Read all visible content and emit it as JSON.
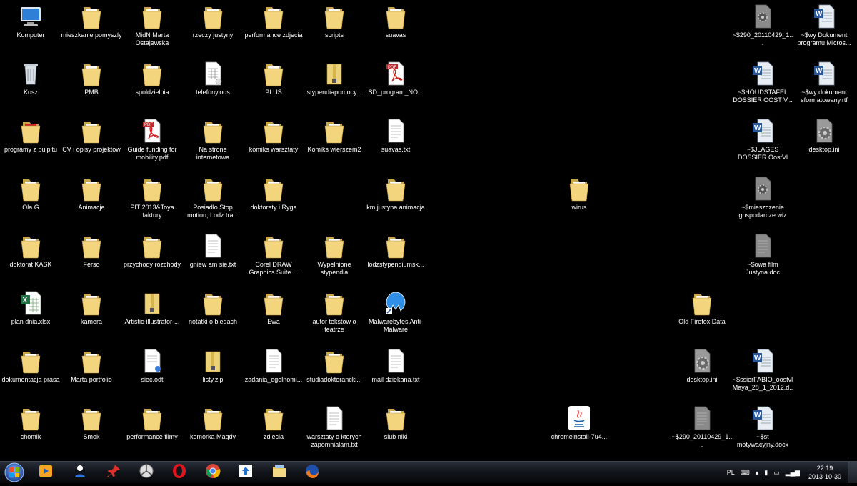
{
  "desktop": {
    "icons": [
      {
        "label": "Komputer",
        "type": "computer"
      },
      {
        "label": "mieszkanie pomyszly",
        "type": "folder"
      },
      {
        "label": "MidN Marta Ostajewska",
        "type": "folder"
      },
      {
        "label": "rzeczy justyny",
        "type": "folder"
      },
      {
        "label": "performance zdjecia",
        "type": "folder"
      },
      {
        "label": "scripts",
        "type": "folder"
      },
      {
        "label": "suavas",
        "type": "folder"
      },
      {
        "label": "~$290_20110429_1...",
        "type": "file-gear"
      },
      {
        "label": "~$wy Dokument programu Micros...",
        "type": "word"
      },
      {
        "label": "Kosz",
        "type": "recycle-bin"
      },
      {
        "label": "PMB",
        "type": "folder"
      },
      {
        "label": "spoldzielnia",
        "type": "folder"
      },
      {
        "label": "telefony.ods",
        "type": "spreadsheet"
      },
      {
        "label": "PLUS",
        "type": "folder"
      },
      {
        "label": "stypendiapomocy...",
        "type": "zip"
      },
      {
        "label": "SD_program_NO...",
        "type": "pdf"
      },
      {
        "label": "~$HOUDSTAFEL DOSSIER OOST V...",
        "type": "word"
      },
      {
        "label": "~$wy dokument sformatowany.rtf",
        "type": "word"
      },
      {
        "label": "programy z pulpitu",
        "type": "folder-red"
      },
      {
        "label": "CV i opisy projektow",
        "type": "folder"
      },
      {
        "label": "Guide funding for mobility.pdf",
        "type": "pdf"
      },
      {
        "label": "Na strone internetowa",
        "type": "folder"
      },
      {
        "label": "komiks warsztaty",
        "type": "folder"
      },
      {
        "label": "Komiks wierszem2",
        "type": "folder"
      },
      {
        "label": "suavas.txt",
        "type": "text"
      },
      {
        "label": "~$JLAGES DOSSIER OostVl ADEMLOZ...",
        "type": "word"
      },
      {
        "label": "desktop.ini",
        "type": "settings"
      },
      {
        "label": "Ola G",
        "type": "folder"
      },
      {
        "label": "Animacje",
        "type": "folder"
      },
      {
        "label": "PIT 2013&Toya faktury",
        "type": "folder"
      },
      {
        "label": "Posiadlo Stop motion, Lodz tra...",
        "type": "folder"
      },
      {
        "label": "doktoraty i Ryga",
        "type": "folder"
      },
      {
        "label": "km justyna animacja",
        "type": "folder"
      },
      {
        "label": "wirus",
        "type": "folder"
      },
      {
        "label": "~$mieszczenie gospodarcze.wiz",
        "type": "file-gear"
      },
      {
        "label": "doktorat KASK",
        "type": "folder"
      },
      {
        "label": "Ferso",
        "type": "folder"
      },
      {
        "label": "przychody rozchody",
        "type": "folder"
      },
      {
        "label": "gniew am sie.txt",
        "type": "text"
      },
      {
        "label": "Corel DRAW Graphics Suite ...",
        "type": "folder"
      },
      {
        "label": "Wypelnione stypendia",
        "type": "folder"
      },
      {
        "label": "lodzstypendiumsk...",
        "type": "folder"
      },
      {
        "label": "~$owa film Justyna.doc",
        "type": "doc-gray"
      },
      {
        "label": "plan dnia.xlsx",
        "type": "excel"
      },
      {
        "label": "kamera",
        "type": "folder"
      },
      {
        "label": "Artistic-illustrator-...",
        "type": "zip"
      },
      {
        "label": "notatki o bledach",
        "type": "folder"
      },
      {
        "label": "Ewa",
        "type": "folder"
      },
      {
        "label": "autor tekstow o teatrze",
        "type": "folder"
      },
      {
        "label": "Malwarebytes Anti-Malware",
        "type": "malwarebytes"
      },
      {
        "label": "Old Firefox Data",
        "type": "folder"
      },
      {
        "label": "dokumentacja prasa",
        "type": "folder"
      },
      {
        "label": "Marta portfolio",
        "type": "folder"
      },
      {
        "label": "siec.odt",
        "type": "odt"
      },
      {
        "label": "listy.zip",
        "type": "zip"
      },
      {
        "label": "zadania_ogolnomi...",
        "type": "text"
      },
      {
        "label": "studiadoktorancki...",
        "type": "folder"
      },
      {
        "label": "mail dziekana.txt",
        "type": "text"
      },
      {
        "label": "desktop.ini",
        "type": "settings"
      },
      {
        "label": "~$ssierFABIO_oostvl Maya_28_1_2012.d...",
        "type": "word"
      },
      {
        "label": "chomik",
        "type": "folder"
      },
      {
        "label": "Smok",
        "type": "folder"
      },
      {
        "label": "performance filmy",
        "type": "folder"
      },
      {
        "label": "komorka Magdy",
        "type": "folder"
      },
      {
        "label": "zdjecia",
        "type": "folder"
      },
      {
        "label": "warsztaty o ktorych zapomnialam.txt",
        "type": "text"
      },
      {
        "label": "slub niki",
        "type": "folder"
      },
      {
        "label": "chromeinstall-7u4...",
        "type": "java"
      },
      {
        "label": "~$290_20110429_1...",
        "type": "doc-gray"
      },
      {
        "label": "~$st motywacyjny.docx",
        "type": "word"
      }
    ]
  },
  "taskbar": {
    "pinned": [
      {
        "name": "media-player-icon"
      },
      {
        "name": "messenger-icon"
      },
      {
        "name": "pushpin-icon"
      },
      {
        "name": "mercedes-icon"
      },
      {
        "name": "opera-icon"
      },
      {
        "name": "chrome-icon"
      },
      {
        "name": "download-icon"
      },
      {
        "name": "file-explorer-icon"
      },
      {
        "name": "firefox-icon"
      }
    ],
    "tray": {
      "language": "PL",
      "time": "22:19",
      "date": "2013-10-30"
    }
  }
}
